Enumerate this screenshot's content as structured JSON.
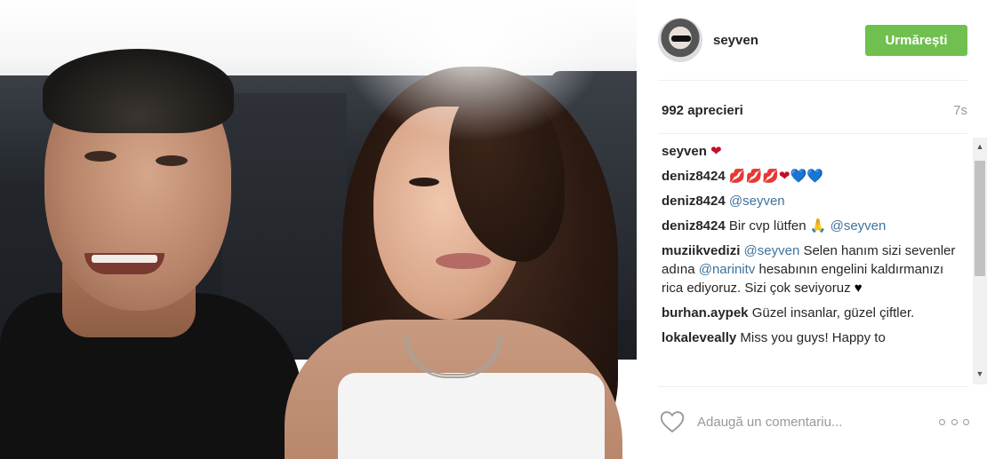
{
  "post": {
    "username": "seyven",
    "follow_label": "Urmărești",
    "likes": "992 aprecieri",
    "time": "7s"
  },
  "comments": [
    {
      "user": "seyven",
      "parts": [
        {
          "t": "emoji",
          "v": "❤"
        }
      ]
    },
    {
      "user": "deniz8424",
      "parts": [
        {
          "t": "emoji",
          "v": "💋💋💋❤"
        },
        {
          "t": "emoji-b",
          "v": "💙💙"
        }
      ]
    },
    {
      "user": "deniz8424",
      "parts": [
        {
          "t": "mention",
          "v": "@seyven"
        }
      ]
    },
    {
      "user": "deniz8424",
      "parts": [
        {
          "t": "text",
          "v": "Bir cvp lütfen 🙏 "
        },
        {
          "t": "mention",
          "v": "@seyven"
        }
      ]
    },
    {
      "user": "muziikvedizi",
      "parts": [
        {
          "t": "mention",
          "v": "@seyven"
        },
        {
          "t": "text",
          "v": " Selen hanım sizi sevenler adına "
        },
        {
          "t": "mention",
          "v": "@narinitv"
        },
        {
          "t": "text",
          "v": " hesabının engelini kaldırmanızı rica ediyoruz. Sizi çok seviyoruz "
        },
        {
          "t": "emoji-k",
          "v": "♥"
        }
      ]
    },
    {
      "user": "burhan.aypek",
      "parts": [
        {
          "t": "text",
          "v": "Güzel insanlar, güzel çiftler."
        }
      ]
    },
    {
      "user": "lokaleveally",
      "parts": [
        {
          "t": "text",
          "v": "Miss you guys! Happy to"
        }
      ]
    }
  ],
  "comment_box": {
    "placeholder": "Adaugă un comentariu..."
  },
  "icons": {
    "like": "heart-outline-icon",
    "more": "more-options-icon",
    "scroll_up": "triangle-up-icon",
    "scroll_down": "triangle-down-icon"
  },
  "colors": {
    "follow_button": "#70c050",
    "mention": "#3f729b",
    "muted": "#999999"
  }
}
